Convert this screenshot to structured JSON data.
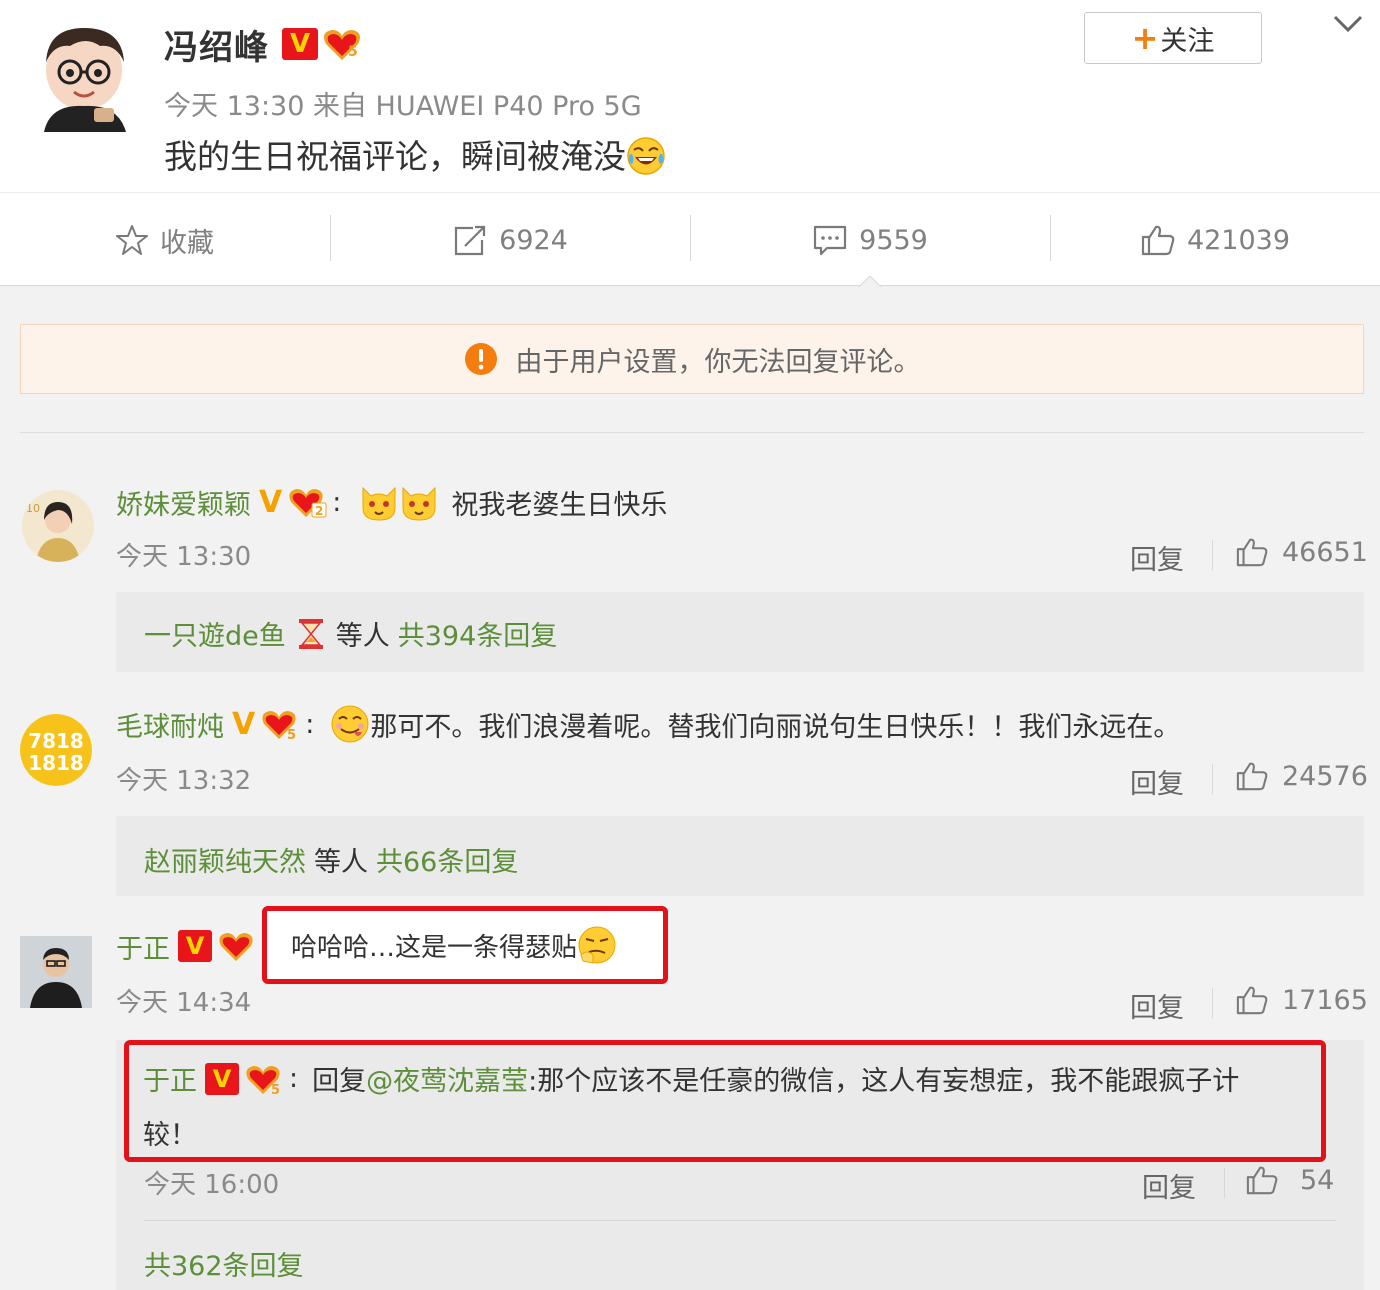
{
  "post": {
    "author": "冯绍峰",
    "meta": "今天 13:30 来自 HUAWEI P40 Pro 5G",
    "text": "我的生日祝福评论，瞬间被淹没",
    "follow_label": "关注",
    "follow_plus": "+",
    "verified_badge": "V"
  },
  "actions": {
    "favorite_label": "收藏",
    "repost_count": "6924",
    "comment_count": "9559",
    "like_count": "421039"
  },
  "notice": {
    "text": "由于用户设置，你无法回复评论。"
  },
  "comments": [
    {
      "user": "娇妹爱颖颖",
      "badge": "V",
      "separator": ":",
      "text": "祝我老婆生日快乐",
      "time": "今天 13:30",
      "reply_label": "回复",
      "likes": "46651",
      "sub": {
        "users": "一只遊de鱼",
        "mid": "等人",
        "count_text": "共394条回复"
      }
    },
    {
      "user": "毛球耐炖",
      "badge": "V",
      "separator": ":",
      "text": "那可不。我们浪漫着呢。替我们向丽说句生日快乐！！我们永远在。",
      "time": "今天 13:32",
      "reply_label": "回复",
      "likes": "24576",
      "sub": {
        "users": "赵丽颖纯天然",
        "mid": "等人",
        "count_text": "共66条回复"
      }
    },
    {
      "user": "于正",
      "badge": "V",
      "text": "哈哈哈…这是一条得瑟贴",
      "time": "今天 14:34",
      "reply_label": "回复",
      "likes": "17165",
      "sub_reply": {
        "user": "于正",
        "badge": "V",
        "separator": ":",
        "prefix": "回复",
        "mention": "@夜莺沈嘉莹",
        "text_line1": ":那个应该不是任豪的微信，这人有妄想症，我不能跟疯子计",
        "text_line2": "较！",
        "time": "今天 16:00",
        "reply_label": "回复",
        "likes": "54"
      },
      "total_replies": "共362条回复"
    }
  ],
  "colors": {
    "accent_green": "#5d8f3a",
    "highlight_red": "#e2111b",
    "follow_orange": "#f47d0d",
    "verified_red": "#e8161a"
  },
  "icons": [
    "star-icon",
    "share-icon",
    "comment-icon",
    "thumbs-up-icon",
    "warning-icon",
    "chevron-down-icon",
    "hourglass-icon"
  ]
}
